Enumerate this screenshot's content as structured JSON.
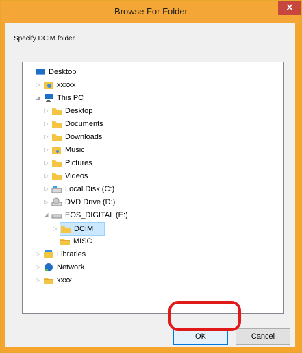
{
  "window": {
    "title": "Browse For Folder",
    "close_label": "×"
  },
  "prompt": "Specify DCIM folder.",
  "tree": [
    {
      "label": "Desktop",
      "icon": "desktop-icon",
      "level": 0,
      "expander": ""
    },
    {
      "label": "xxxxx",
      "icon": "user-folder-icon",
      "level": 1,
      "expander": "▷"
    },
    {
      "label": "This PC",
      "icon": "computer-icon",
      "level": 1,
      "expander": "◢"
    },
    {
      "label": "Desktop",
      "icon": "desktop-folder-icon",
      "level": 2,
      "expander": "▷"
    },
    {
      "label": "Documents",
      "icon": "documents-icon",
      "level": 2,
      "expander": "▷"
    },
    {
      "label": "Downloads",
      "icon": "downloads-icon",
      "level": 2,
      "expander": "▷"
    },
    {
      "label": "Music",
      "icon": "music-icon",
      "level": 2,
      "expander": "▷"
    },
    {
      "label": "Pictures",
      "icon": "pictures-icon",
      "level": 2,
      "expander": "▷"
    },
    {
      "label": "Videos",
      "icon": "videos-icon",
      "level": 2,
      "expander": "▷"
    },
    {
      "label": "Local Disk (C:)",
      "icon": "local-disk-icon",
      "level": 2,
      "expander": "▷"
    },
    {
      "label": "DVD Drive (D:)",
      "icon": "dvd-drive-icon",
      "level": 2,
      "expander": "▷"
    },
    {
      "label": "EOS_DIGITAL (E:)",
      "icon": "removable-drive-icon",
      "level": 2,
      "expander": "◢"
    },
    {
      "label": "DCIM",
      "icon": "folder-icon",
      "level": 3,
      "expander": "▷",
      "selected": true
    },
    {
      "label": "MISC",
      "icon": "folder-icon",
      "level": 3,
      "expander": ""
    },
    {
      "label": "Libraries",
      "icon": "libraries-icon",
      "level": 1,
      "expander": "▷"
    },
    {
      "label": "Network",
      "icon": "network-icon",
      "level": 1,
      "expander": "▷"
    },
    {
      "label": "xxxx",
      "icon": "folder-icon",
      "level": 1,
      "expander": "▷"
    }
  ],
  "buttons": {
    "ok": "OK",
    "cancel": "Cancel"
  }
}
